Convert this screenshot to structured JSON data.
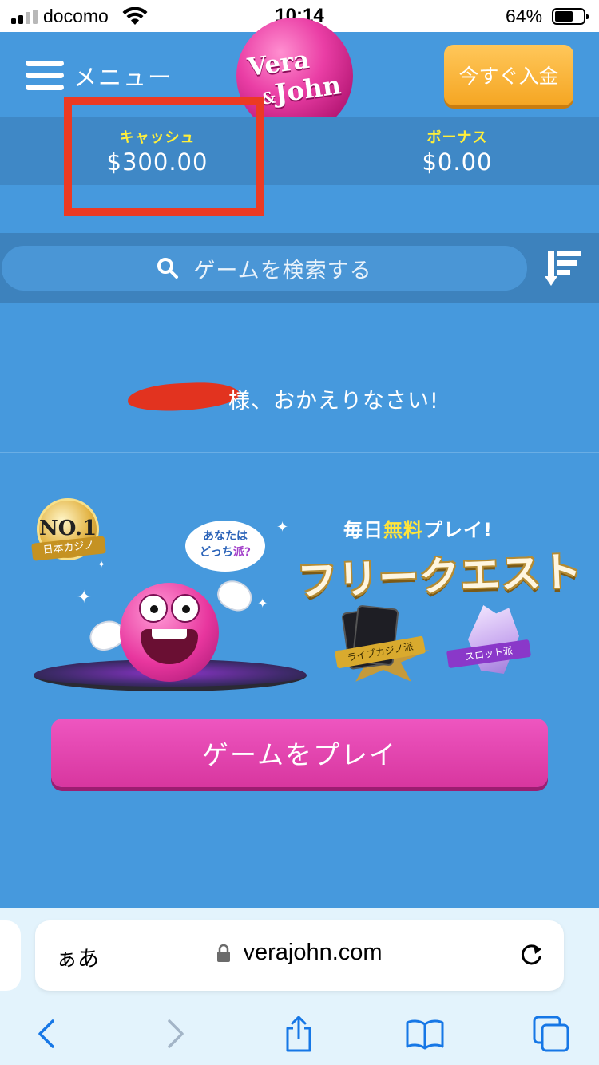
{
  "status_bar": {
    "carrier": "docomo",
    "time": "10:14",
    "battery_percent": "64%",
    "battery_level": 0.64
  },
  "header": {
    "menu_label": "メニュー",
    "logo_line1": "Vera",
    "logo_amp": "&",
    "logo_line2": "John",
    "deposit_label": "今すぐ入金"
  },
  "balance": {
    "cash_label": "キャッシュ",
    "cash_value": "$300.00",
    "bonus_label": "ボーナス",
    "bonus_value": "$0.00"
  },
  "search": {
    "placeholder": "ゲームを検索する"
  },
  "welcome": {
    "message": "様、おかえりなさい!"
  },
  "promo": {
    "badge_no": "NO.1",
    "badge_ribbon": "日本カジノ",
    "speech_line1": "あなたは",
    "speech_line2": "どっち",
    "speech_line2_suffix": "派?",
    "tagline_prefix": "毎日",
    "tagline_highlight": "無料",
    "tagline_suffix": "プレイ!",
    "title": "フリークエスト",
    "live_ribbon": "ライブカジノ派",
    "slot_ribbon": "スロット派"
  },
  "play_button": {
    "label": "ゲームをプレイ"
  },
  "safari": {
    "aa_label": "ぁあ",
    "url": "verajohn.com"
  },
  "colors": {
    "background": "#4699dd",
    "accent_pink": "#e8369e",
    "accent_orange": "#f5a623",
    "label_yellow": "#ffef3a",
    "highlight_red": "#ec3a23"
  },
  "icons": [
    "hamburger-icon",
    "search-icon",
    "sort-icon",
    "lock-icon",
    "reload-icon",
    "back-icon",
    "forward-icon",
    "share-icon",
    "bookmarks-icon",
    "tabs-icon",
    "wifi-icon",
    "signal-icon",
    "battery-icon"
  ]
}
